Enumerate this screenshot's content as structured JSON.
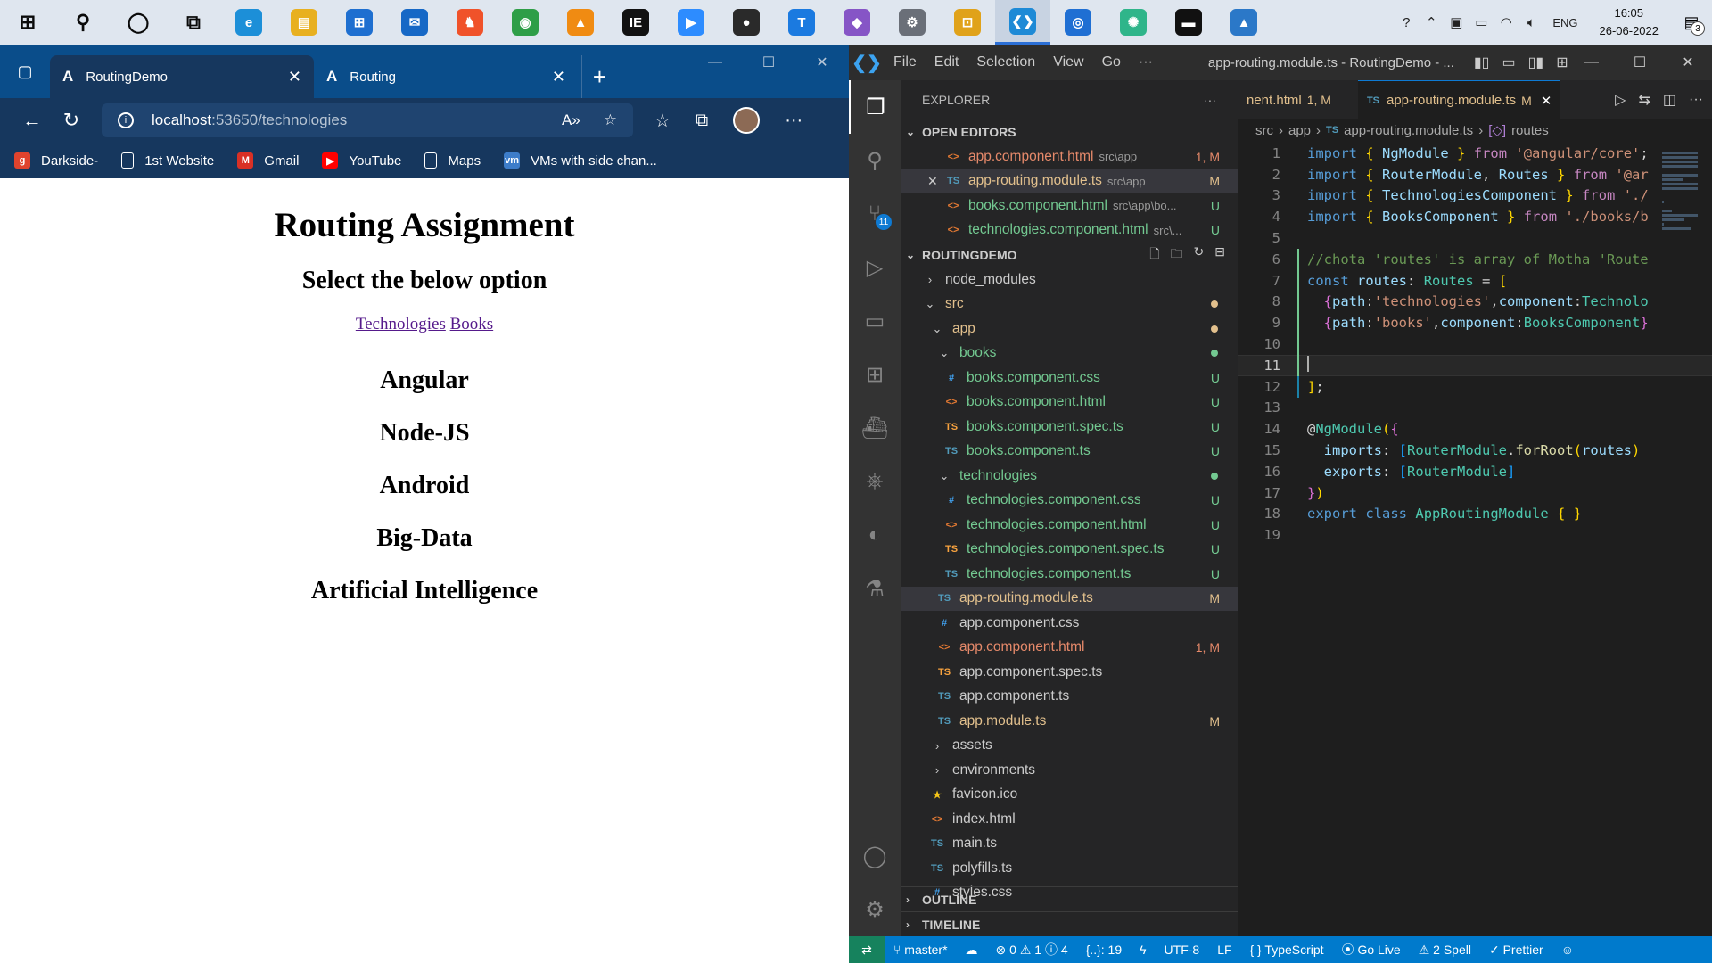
{
  "taskbar": {
    "icons": [
      {
        "name": "windows-start-icon",
        "glyph": "⊞",
        "color": "#0a0a0a",
        "bg": "transparent"
      },
      {
        "name": "search-icon",
        "glyph": "⚲",
        "color": "#0a0a0a",
        "bg": "transparent"
      },
      {
        "name": "cortana-icon",
        "glyph": "◯",
        "color": "#0a0a0a",
        "bg": "transparent"
      },
      {
        "name": "task-view-icon",
        "glyph": "⧉",
        "color": "#0a0a0a",
        "bg": "transparent"
      },
      {
        "name": "edge-icon",
        "glyph": "e",
        "color": "#ffffff",
        "bg": "#1c8fd8"
      },
      {
        "name": "file-explorer-icon",
        "glyph": "▤",
        "color": "#ffffff",
        "bg": "#e8b020"
      },
      {
        "name": "ms-store-icon",
        "glyph": "⊞",
        "color": "#ffffff",
        "bg": "#1e6fd0"
      },
      {
        "name": "mail-icon",
        "glyph": "✉",
        "color": "#ffffff",
        "bg": "#1668c6"
      },
      {
        "name": "brave-icon",
        "glyph": "♞",
        "color": "#ffffff",
        "bg": "#f0522a"
      },
      {
        "name": "chrome-icon",
        "glyph": "◉",
        "color": "#ffffff",
        "bg": "#2e9e47"
      },
      {
        "name": "vlc-icon",
        "glyph": "▲",
        "color": "#ffffff",
        "bg": "#f08b12"
      },
      {
        "name": "intellij-icon",
        "glyph": "IE",
        "color": "#ffffff",
        "bg": "#111111"
      },
      {
        "name": "zoom-icon",
        "glyph": "▶",
        "color": "#ffffff",
        "bg": "#2d8cff"
      },
      {
        "name": "obs-icon",
        "glyph": "●",
        "color": "#ffffff",
        "bg": "#2a2a2a"
      },
      {
        "name": "t-app-icon",
        "glyph": "T",
        "color": "#ffffff",
        "bg": "#1b7ae0"
      },
      {
        "name": "visual-studio-icon",
        "glyph": "◆",
        "color": "#ffffff",
        "bg": "#8655c6"
      },
      {
        "name": "settings-app-icon",
        "glyph": "⚙",
        "color": "#ffffff",
        "bg": "#6a6f78"
      },
      {
        "name": "grid-app-icon",
        "glyph": "⊡",
        "color": "#ffffff",
        "bg": "#e0a21a"
      },
      {
        "name": "vscode-taskbar-icon",
        "glyph": "❮❯",
        "color": "#ffffff",
        "bg": "#1e8ad6"
      },
      {
        "name": "blue-app-icon",
        "glyph": "◎",
        "color": "#ffffff",
        "bg": "#1f6fd3"
      },
      {
        "name": "atom-icon",
        "glyph": "✺",
        "color": "#ffffff",
        "bg": "#2fb58a"
      },
      {
        "name": "terminal-icon",
        "glyph": "▬",
        "color": "#ffffff",
        "bg": "#111111"
      },
      {
        "name": "photos-icon",
        "glyph": "▲",
        "color": "#ffffff",
        "bg": "#2b78c8"
      }
    ],
    "active_index": 18,
    "tray": {
      "lang": "ENG",
      "time": "16:05",
      "date": "26-06-2022",
      "notifications": "3"
    }
  },
  "browser": {
    "tabs": [
      {
        "favicon": "A",
        "title": "RoutingDemo"
      },
      {
        "favicon": "A",
        "title": "Routing"
      }
    ],
    "url_host": "localhost",
    "url_path": ":53650/technologies",
    "bookmarks": [
      {
        "label": "Darkside-",
        "icon": "g",
        "color": "#e0432d"
      },
      {
        "label": "1st Website",
        "icon": "▯",
        "color": "transparent"
      },
      {
        "label": "Gmail",
        "icon": "M",
        "color": "#d93025"
      },
      {
        "label": "YouTube",
        "icon": "▶",
        "color": "#ff0000"
      },
      {
        "label": "Maps",
        "icon": "▯",
        "color": "transparent"
      },
      {
        "label": "VMs with side chan...",
        "icon": "vm",
        "color": "#3d7dca"
      }
    ],
    "page": {
      "title": "Routing Assignment",
      "subtitle": "Select the below option",
      "link_technologies": "Technologies",
      "link_books": "Books",
      "technologies": [
        "Angular",
        "Node-JS",
        "Android",
        "Big-Data",
        "Artificial Intelligence"
      ]
    }
  },
  "vscode": {
    "menu": [
      "File",
      "Edit",
      "Selection",
      "View",
      "Go",
      "···"
    ],
    "window_title": "app-routing.module.ts - RoutingDemo - ...",
    "explorer_label": "EXPLORER",
    "open_editors_label": "OPEN EDITORS",
    "open_editors": [
      {
        "icon": "<>",
        "name": "app.component.html",
        "desc": "src\\app",
        "status": "1, M",
        "cls": "red",
        "ic": "html-ic"
      },
      {
        "icon": "TS",
        "name": "app-routing.module.ts",
        "desc": "src\\app",
        "status": "M",
        "cls": "mod",
        "ic": "ts-ic"
      },
      {
        "icon": "<>",
        "name": "books.component.html",
        "desc": "src\\app\\bo...",
        "status": "U",
        "cls": "untr",
        "ic": "html-ic"
      },
      {
        "icon": "<>",
        "name": "technologies.component.html",
        "desc": "src\\...",
        "status": "U",
        "cls": "untr",
        "ic": "html-ic"
      }
    ],
    "project_label": "ROUTINGDEMO",
    "tree": [
      {
        "indent": 0,
        "chev": "›",
        "icon": "",
        "name": "node_modules",
        "cls": "plain",
        "status": "",
        "dot": ""
      },
      {
        "indent": 0,
        "chev": "⌄",
        "icon": "",
        "name": "src",
        "cls": "mod",
        "status": "",
        "dot": "#e2c08d"
      },
      {
        "indent": 1,
        "chev": "⌄",
        "icon": "",
        "name": "app",
        "cls": "mod",
        "status": "",
        "dot": "#e2c08d"
      },
      {
        "indent": 2,
        "chev": "⌄",
        "icon": "",
        "name": "books",
        "cls": "untr",
        "status": "",
        "dot": "#73c991"
      },
      {
        "indent": 3,
        "chev": "",
        "icon": "#",
        "ic": "css-ic",
        "name": "books.component.css",
        "cls": "untr",
        "status": "U",
        "dot": ""
      },
      {
        "indent": 3,
        "chev": "",
        "icon": "<>",
        "ic": "html-ic",
        "name": "books.component.html",
        "cls": "untr",
        "status": "U",
        "dot": ""
      },
      {
        "indent": 3,
        "chev": "",
        "icon": "TS",
        "ic": "spec-ic",
        "name": "books.component.spec.ts",
        "cls": "untr",
        "status": "U",
        "dot": ""
      },
      {
        "indent": 3,
        "chev": "",
        "icon": "TS",
        "ic": "ts-ic",
        "name": "books.component.ts",
        "cls": "untr",
        "status": "U",
        "dot": ""
      },
      {
        "indent": 2,
        "chev": "⌄",
        "icon": "",
        "name": "technologies",
        "cls": "untr",
        "status": "",
        "dot": "#73c991"
      },
      {
        "indent": 3,
        "chev": "",
        "icon": "#",
        "ic": "css-ic",
        "name": "technologies.component.css",
        "cls": "untr",
        "status": "U",
        "dot": ""
      },
      {
        "indent": 3,
        "chev": "",
        "icon": "<>",
        "ic": "html-ic",
        "name": "technologies.component.html",
        "cls": "untr",
        "status": "U",
        "dot": ""
      },
      {
        "indent": 3,
        "chev": "",
        "icon": "TS",
        "ic": "spec-ic",
        "name": "technologies.component.spec.ts",
        "cls": "untr",
        "status": "U",
        "dot": ""
      },
      {
        "indent": 3,
        "chev": "",
        "icon": "TS",
        "ic": "ts-ic",
        "name": "technologies.component.ts",
        "cls": "untr",
        "status": "U",
        "dot": ""
      },
      {
        "indent": 2,
        "chev": "",
        "icon": "TS",
        "ic": "ts-ic",
        "name": "app-routing.module.ts",
        "cls": "mod",
        "status": "M",
        "dot": "",
        "sel": true
      },
      {
        "indent": 2,
        "chev": "",
        "icon": "#",
        "ic": "css-ic",
        "name": "app.component.css",
        "cls": "plain",
        "status": "",
        "dot": ""
      },
      {
        "indent": 2,
        "chev": "",
        "icon": "<>",
        "ic": "html-ic",
        "name": "app.component.html",
        "cls": "red",
        "status": "1, M",
        "dot": ""
      },
      {
        "indent": 2,
        "chev": "",
        "icon": "TS",
        "ic": "spec-ic",
        "name": "app.component.spec.ts",
        "cls": "plain",
        "status": "",
        "dot": ""
      },
      {
        "indent": 2,
        "chev": "",
        "icon": "TS",
        "ic": "ts-ic",
        "name": "app.component.ts",
        "cls": "plain",
        "status": "",
        "dot": ""
      },
      {
        "indent": 2,
        "chev": "",
        "icon": "TS",
        "ic": "ts-ic",
        "name": "app.module.ts",
        "cls": "mod",
        "status": "M",
        "dot": ""
      },
      {
        "indent": 1,
        "chev": "›",
        "icon": "",
        "name": "assets",
        "cls": "plain",
        "status": "",
        "dot": ""
      },
      {
        "indent": 1,
        "chev": "›",
        "icon": "",
        "name": "environments",
        "cls": "plain",
        "status": "",
        "dot": ""
      },
      {
        "indent": 1,
        "chev": "",
        "icon": "★",
        "ic": "fav-ic",
        "name": "favicon.ico",
        "cls": "plain",
        "status": "",
        "dot": ""
      },
      {
        "indent": 1,
        "chev": "",
        "icon": "<>",
        "ic": "html-ic",
        "name": "index.html",
        "cls": "plain",
        "status": "",
        "dot": ""
      },
      {
        "indent": 1,
        "chev": "",
        "icon": "TS",
        "ic": "ts-ic",
        "name": "main.ts",
        "cls": "plain",
        "status": "",
        "dot": ""
      },
      {
        "indent": 1,
        "chev": "",
        "icon": "TS",
        "ic": "ts-ic",
        "name": "polyfills.ts",
        "cls": "plain",
        "status": "",
        "dot": ""
      },
      {
        "indent": 1,
        "chev": "",
        "icon": "#",
        "ic": "css-ic",
        "name": "styles.css",
        "cls": "plain",
        "status": "",
        "dot": ""
      }
    ],
    "outline_label": "OUTLINE",
    "timeline_label": "TIMELINE",
    "editor_tabs": [
      {
        "name": "nent.html",
        "status": "1, M",
        "active": false
      },
      {
        "name": "app-routing.module.ts",
        "status": "M",
        "active": true
      }
    ],
    "breadcrumb": [
      "src",
      "app",
      "app-routing.module.ts",
      "routes"
    ],
    "code_lines": [
      [
        [
          "kw",
          "import"
        ],
        [
          "pl",
          " "
        ],
        [
          "br1",
          "{"
        ],
        [
          "pl",
          " "
        ],
        [
          "vr",
          "NgModule"
        ],
        [
          "pl",
          " "
        ],
        [
          "br1",
          "}"
        ],
        [
          "pl",
          " "
        ],
        [
          "ctl",
          "from"
        ],
        [
          "pl",
          " "
        ],
        [
          "str",
          "'@angular/core'"
        ],
        [
          "pl",
          ";"
        ]
      ],
      [
        [
          "kw",
          "import"
        ],
        [
          "pl",
          " "
        ],
        [
          "br1",
          "{"
        ],
        [
          "pl",
          " "
        ],
        [
          "vr",
          "RouterModule"
        ],
        [
          "pl",
          ", "
        ],
        [
          "vr",
          "Routes"
        ],
        [
          "pl",
          " "
        ],
        [
          "br1",
          "}"
        ],
        [
          "pl",
          " "
        ],
        [
          "ctl",
          "from"
        ],
        [
          "pl",
          " "
        ],
        [
          "str",
          "'@ar"
        ]
      ],
      [
        [
          "kw",
          "import"
        ],
        [
          "pl",
          " "
        ],
        [
          "br1",
          "{"
        ],
        [
          "pl",
          " "
        ],
        [
          "vr",
          "TechnologiesComponent"
        ],
        [
          "pl",
          " "
        ],
        [
          "br1",
          "}"
        ],
        [
          "pl",
          " "
        ],
        [
          "ctl",
          "from"
        ],
        [
          "pl",
          " "
        ],
        [
          "str",
          "'./"
        ]
      ],
      [
        [
          "kw",
          "import"
        ],
        [
          "pl",
          " "
        ],
        [
          "br1",
          "{"
        ],
        [
          "pl",
          " "
        ],
        [
          "vr",
          "BooksComponent"
        ],
        [
          "pl",
          " "
        ],
        [
          "br1",
          "}"
        ],
        [
          "pl",
          " "
        ],
        [
          "ctl",
          "from"
        ],
        [
          "pl",
          " "
        ],
        [
          "str",
          "'./books/b"
        ]
      ],
      [],
      [
        [
          "cm",
          "//chota 'routes' is array of Motha 'Route"
        ]
      ],
      [
        [
          "kw",
          "const"
        ],
        [
          "pl",
          " "
        ],
        [
          "vr",
          "routes"
        ],
        [
          "pl",
          ": "
        ],
        [
          "ty",
          "Routes"
        ],
        [
          "pl",
          " = "
        ],
        [
          "br1",
          "["
        ]
      ],
      [
        [
          "pl",
          "  "
        ],
        [
          "br2",
          "{"
        ],
        [
          "vr",
          "path"
        ],
        [
          "pl",
          ":"
        ],
        [
          "str",
          "'technologies'"
        ],
        [
          "pl",
          ","
        ],
        [
          "vr",
          "component"
        ],
        [
          "pl",
          ":"
        ],
        [
          "ty",
          "Technolo"
        ]
      ],
      [
        [
          "pl",
          "  "
        ],
        [
          "br2",
          "{"
        ],
        [
          "vr",
          "path"
        ],
        [
          "pl",
          ":"
        ],
        [
          "str",
          "'books'"
        ],
        [
          "pl",
          ","
        ],
        [
          "vr",
          "component"
        ],
        [
          "pl",
          ":"
        ],
        [
          "ty",
          "BooksComponent"
        ],
        [
          "br2",
          "}"
        ]
      ],
      [],
      [],
      [
        [
          "br1",
          "]"
        ],
        [
          "pl",
          ";"
        ]
      ],
      [],
      [
        [
          "pl",
          "@"
        ],
        [
          "ty",
          "NgModule"
        ],
        [
          "br1",
          "("
        ],
        [
          "br2",
          "{"
        ]
      ],
      [
        [
          "pl",
          "  "
        ],
        [
          "vr",
          "imports"
        ],
        [
          "pl",
          ": "
        ],
        [
          "br3",
          "["
        ],
        [
          "ty",
          "RouterModule"
        ],
        [
          "pl",
          "."
        ],
        [
          "fn",
          "forRoot"
        ],
        [
          "br1",
          "("
        ],
        [
          "vr",
          "routes"
        ],
        [
          "br1",
          ")"
        ]
      ],
      [
        [
          "pl",
          "  "
        ],
        [
          "vr",
          "exports"
        ],
        [
          "pl",
          ": "
        ],
        [
          "br3",
          "["
        ],
        [
          "ty",
          "RouterModule"
        ],
        [
          "br3",
          "]"
        ]
      ],
      [
        [
          "br2",
          "}"
        ],
        [
          "br1",
          ")"
        ]
      ],
      [
        [
          "kw",
          "export"
        ],
        [
          "pl",
          " "
        ],
        [
          "kw",
          "class"
        ],
        [
          "pl",
          " "
        ],
        [
          "ty",
          "AppRoutingModule"
        ],
        [
          "pl",
          " "
        ],
        [
          "br1",
          "{"
        ],
        [
          "pl",
          " "
        ],
        [
          "br1",
          "}"
        ]
      ],
      []
    ],
    "current_line": 11,
    "status": {
      "branch": "master*",
      "problems": "⊗ 0 ⚠ 1 ⓘ 4",
      "cursor": "{..}: 19",
      "encoding": "UTF-8",
      "eol": "LF",
      "language": "{ } TypeScript",
      "golive": "Go Live",
      "spell": "⚠ 2 Spell",
      "prettier": "✓ Prettier"
    }
  }
}
